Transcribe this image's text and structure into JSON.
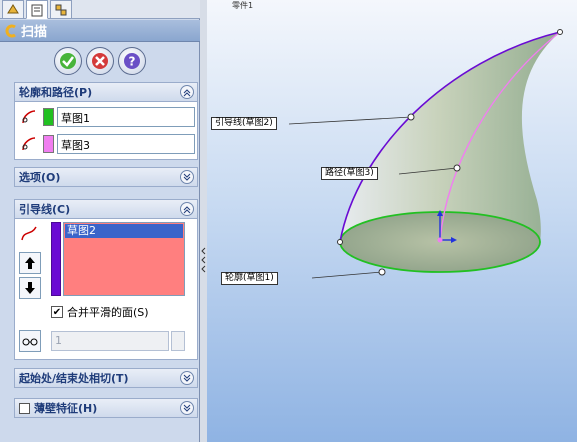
{
  "tabs": [
    {
      "icon": "feature-manager-icon"
    },
    {
      "icon": "property-manager-icon"
    },
    {
      "icon": "configuration-manager-icon"
    }
  ],
  "feature": {
    "title": "扫描",
    "icon": "sweep-icon"
  },
  "actions": {
    "ok": "ok-icon",
    "cancel": "cancel-icon",
    "help": "help-icon"
  },
  "profile_path": {
    "header": "轮廓和路径(P)",
    "profile": {
      "value": "草图1",
      "color": "#22c022"
    },
    "path": {
      "value": "草图3",
      "color": "#f07ef0"
    }
  },
  "options": {
    "header": "选项(O)"
  },
  "guide_curves": {
    "header": "引导线(C)",
    "items": [
      "草图2"
    ],
    "list_color": "#ff7f7f",
    "stripe_color": "#6a0bd3",
    "merge_faces": {
      "label": "合并平滑的面(S)",
      "checked": true
    },
    "spin_value": "1"
  },
  "tangency": {
    "header": "起始处/结束处相切(T)"
  },
  "thin_feature": {
    "header": "薄壁特征(H)",
    "checked": false
  },
  "viewport": {
    "tree_fragment": "零件1",
    "callouts": {
      "guide": "引导线(草图2)",
      "path": "路径(草图3)",
      "profile": "轮廓(草图1)"
    }
  }
}
